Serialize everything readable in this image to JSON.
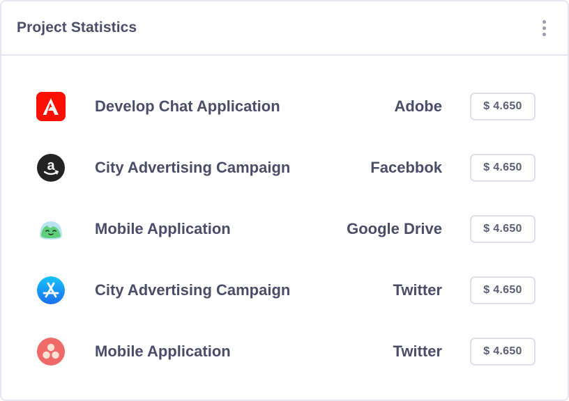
{
  "card": {
    "title": "Project Statistics",
    "menu_icon": "kebab-vertical-icon"
  },
  "projects": [
    {
      "logo": "adobe-logo-icon",
      "name": "Develop Chat Application",
      "client": "Adobe",
      "price": "$ 4.650"
    },
    {
      "logo": "amazon-logo-icon",
      "name": "City Advertising Campaign",
      "client": "Facebbok",
      "price": "$ 4.650"
    },
    {
      "logo": "basecamp-logo-icon",
      "name": "Mobile Application",
      "client": "Google Drive",
      "price": "$ 4.650"
    },
    {
      "logo": "app-store-logo-icon",
      "name": "City Advertising Campaign",
      "client": "Twitter",
      "price": "$ 4.650"
    },
    {
      "logo": "asana-logo-icon",
      "name": "Mobile Application",
      "client": "Twitter",
      "price": "$ 4.650"
    }
  ],
  "colors": {
    "text": "#4b4d68",
    "border": "#e3e4ee",
    "adobe_red": "#fa0f00",
    "amazon_dark": "#232323",
    "app_store_blue": "#1a8ef5",
    "asana_coral": "#f06a6a",
    "basecamp_green": "#5ecf7a"
  }
}
